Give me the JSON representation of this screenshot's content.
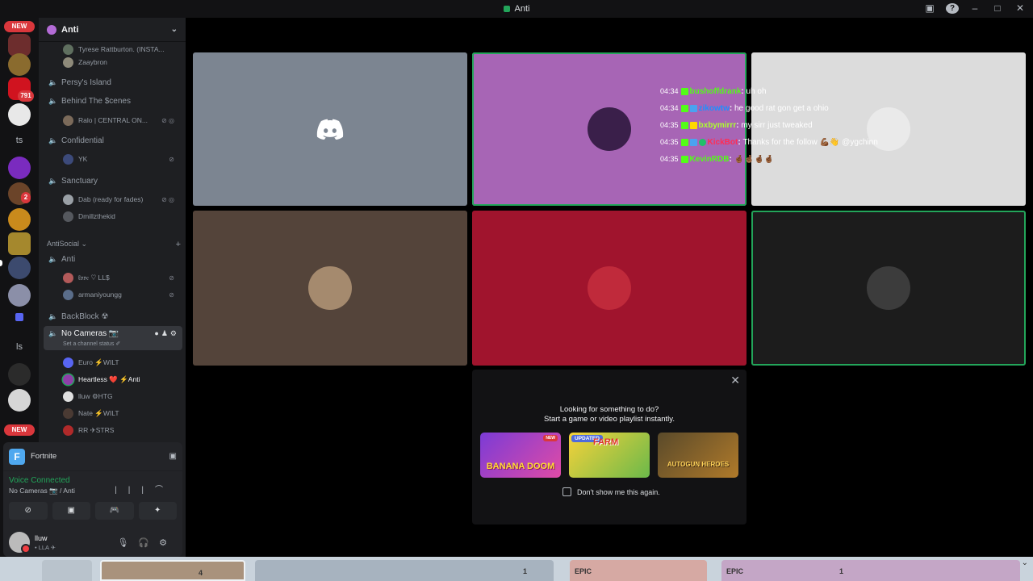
{
  "titlebar": {
    "title": "Anti"
  },
  "rail": {
    "new_top": "NEW",
    "new_bottom": "NEW",
    "badge_791": "791",
    "badge_2": "2",
    "text_server_1": "ts",
    "text_server_2": "ls"
  },
  "server": {
    "name": "Anti"
  },
  "channels": [
    {
      "name": "Persy's Island"
    },
    {
      "name": "Behind The $cenes"
    },
    {
      "name": "Confidential"
    },
    {
      "name": "Sanctuary"
    },
    {
      "name": "Anti"
    },
    {
      "name": "BackBlock ☢"
    },
    {
      "name": "No Cameras 📷",
      "status_placeholder": "Set a channel status ✐"
    }
  ],
  "users": {
    "u0": "Tyrese Rattburton. (INSTA...",
    "u1": "Zaaybron",
    "u2": "Ralo | CENTRAL ON...",
    "u3": "YK",
    "u4": "Dab (ready for fades)",
    "u5": "Dmillzthekid",
    "u6": "ℓ𝔬𝔳𝔢 ♡ LL$",
    "u7": "armaniyoungg",
    "u8": "Euro ⚡WILT",
    "u9": "Heartless ❤️ ⚡Anti",
    "u10": "lluw ⚙HTG",
    "u11": "Nate ⚡WILT",
    "u12": "RR ✈STRS"
  },
  "category": {
    "name": "AntiSocial",
    "chevron": "⌄"
  },
  "panel": {
    "activity": "Fortnite",
    "voice_status": "Voice Connected",
    "voice_location": "No Cameras 📷 / Anti",
    "account_name": "lluw",
    "account_status": "• LLA ✈"
  },
  "chat": [
    {
      "time": "04:34",
      "user": "bushoffdrank",
      "color": "#53fc18",
      "msg": "uh oh"
    },
    {
      "time": "04:34",
      "user": "zikowtw",
      "color": "#1e90ff",
      "msg": "he good rat gon get a ohio"
    },
    {
      "time": "04:35",
      "user": "bxbymirrr",
      "color": "#adff2f",
      "msg": "my sirr just tweaked"
    },
    {
      "time": "04:35",
      "user": "KickBot",
      "color": "#ff2d55",
      "msg": "Thanks for the follow 💪🏾👋 @ygchinn"
    },
    {
      "time": "04:35",
      "user": "KevinRDB",
      "color": "#53fc18",
      "msg": "🤞🏾🤞🏾🤞🏾🤞🏾"
    }
  ],
  "popup": {
    "line1": "Looking for something to do?",
    "line2": "Start a game or video playlist instantly.",
    "cards": [
      {
        "title": "BANANA DOOM",
        "tag": "NEW"
      },
      {
        "title": "FARM",
        "tag": "UPDATED"
      },
      {
        "title": "AUTOGUN HEROES",
        "tag": ""
      }
    ],
    "checkbox": "Don't show me this again."
  },
  "taskbar": {
    "badge_a": "4",
    "badge_b": "1",
    "badge_c": "1",
    "epic_a": "EPIC",
    "epic_b": "EPIC"
  },
  "colors": {
    "accent_green": "#23a55a",
    "danger_red": "#da373c"
  }
}
